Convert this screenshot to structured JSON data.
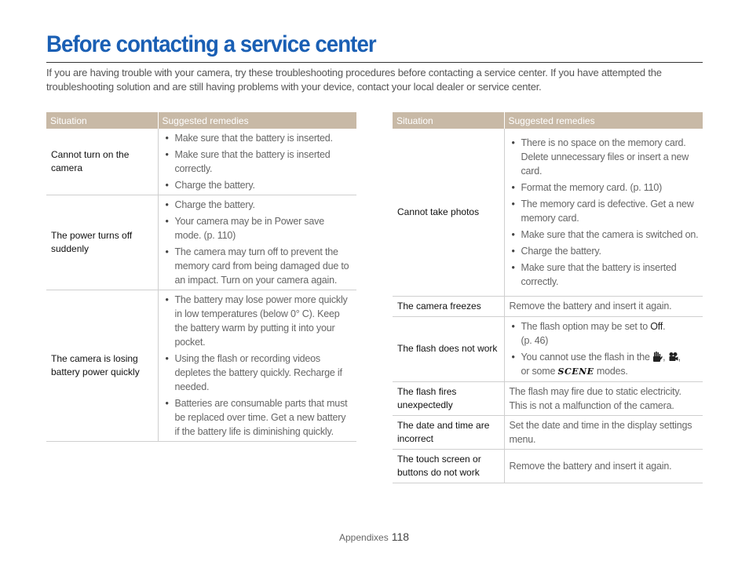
{
  "page": {
    "title": "Before contacting a service center",
    "intro": "If you are having trouble with your camera, try these troubleshooting procedures before contacting a service center. If you have attempted the troubleshooting solution and are still having problems with your device, contact your local dealer or service center.",
    "accent_color": "#1a5fb4",
    "header_color": "#c8b9a6"
  },
  "left_table": {
    "headers": [
      "Situation",
      "Suggested remedies"
    ],
    "rows": [
      {
        "situation": "Cannot turn on the camera",
        "remedies": [
          "Make sure that the battery is inserted.",
          "Make sure that the battery is inserted correctly.",
          "Charge the battery."
        ]
      },
      {
        "situation": "The power turns off suddenly",
        "remedies": [
          "Charge the battery.",
          "Your camera may be in Power save mode. (p. 110)",
          "The camera may turn off to prevent the memory card from being damaged due to an impact. Turn on your camera again."
        ]
      },
      {
        "situation": "The camera is losing battery power quickly",
        "remedies": [
          "The battery may lose power more quickly in low temperatures (below 0° C). Keep the battery warm by putting it into your pocket.",
          "Using the flash or recording videos depletes the battery quickly. Recharge if needed.",
          "Batteries are consumable parts that must be replaced over time. Get a new battery if the battery life is diminishing quickly."
        ]
      }
    ]
  },
  "right_table": {
    "headers": [
      "Situation",
      "Suggested remedies"
    ],
    "rows": [
      {
        "situation": "Cannot take photos",
        "remedies": [
          "There is no space on the memory card. Delete unnecessary files or insert a new card.",
          "Format the memory card. (p. 110)",
          "The memory card is defective. Get a new memory card.",
          "Make sure that the camera is switched on.",
          "Charge the battery.",
          "Make sure that the battery is inserted correctly."
        ]
      },
      {
        "situation": "The camera freezes",
        "remedy_text": "Remove the battery and insert it again."
      },
      {
        "situation": "The flash does not work",
        "flash_option": {
          "before": "The flash option may be set to ",
          "bold": "Off",
          "after": ".",
          "ref": "(p. 46)"
        },
        "flash_modes": {
          "before": "You cannot use the flash in the",
          "sep1": ",",
          "sep2": ",",
          "mid": "or some",
          "scene_label": "SCENE",
          "after": "modes.",
          "icons": [
            "hand-stabilization-icon",
            "movie-camera-icon",
            "scene-icon"
          ]
        }
      },
      {
        "situation": "The flash fires unexpectedly",
        "remedy_text": "The flash may fire due to static electricity. This is not a malfunction of the camera."
      },
      {
        "situation": "The date and time are incorrect",
        "remedy_text": "Set the date and time in the display settings menu."
      },
      {
        "situation": "The touch screen or buttons do not work",
        "remedy_text": "Remove the battery and insert it again."
      }
    ]
  },
  "footer": {
    "section": "Appendixes",
    "page_number": "118"
  }
}
